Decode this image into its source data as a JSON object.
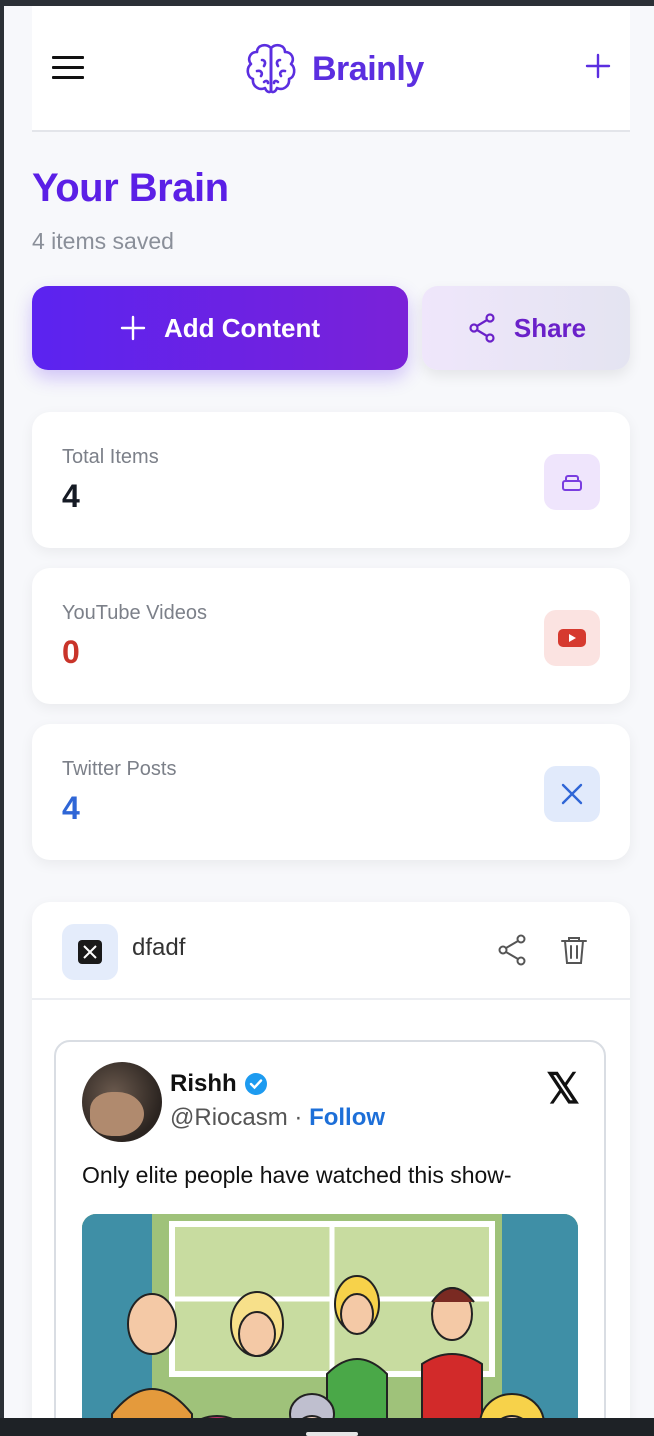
{
  "app": {
    "name": "Brainly"
  },
  "page": {
    "title": "Your Brain",
    "subtitle": "4 items saved"
  },
  "actions": {
    "add_label": "Add Content",
    "share_label": "Share"
  },
  "stats": [
    {
      "label": "Total Items",
      "value": "4",
      "color": "#151a24",
      "icon": "layers-icon"
    },
    {
      "label": "YouTube Videos",
      "value": "0",
      "color": "#c9342a",
      "icon": "youtube-icon"
    },
    {
      "label": "Twitter Posts",
      "value": "4",
      "color": "#2f66d6",
      "icon": "x-icon"
    }
  ],
  "card": {
    "title": "dfadf",
    "tweet": {
      "author": "Rishh",
      "handle": "@Riocasm",
      "separator": "·",
      "follow_label": "Follow",
      "text": "Only elite people have watched this show-",
      "x_glyph": "𝕏"
    }
  }
}
